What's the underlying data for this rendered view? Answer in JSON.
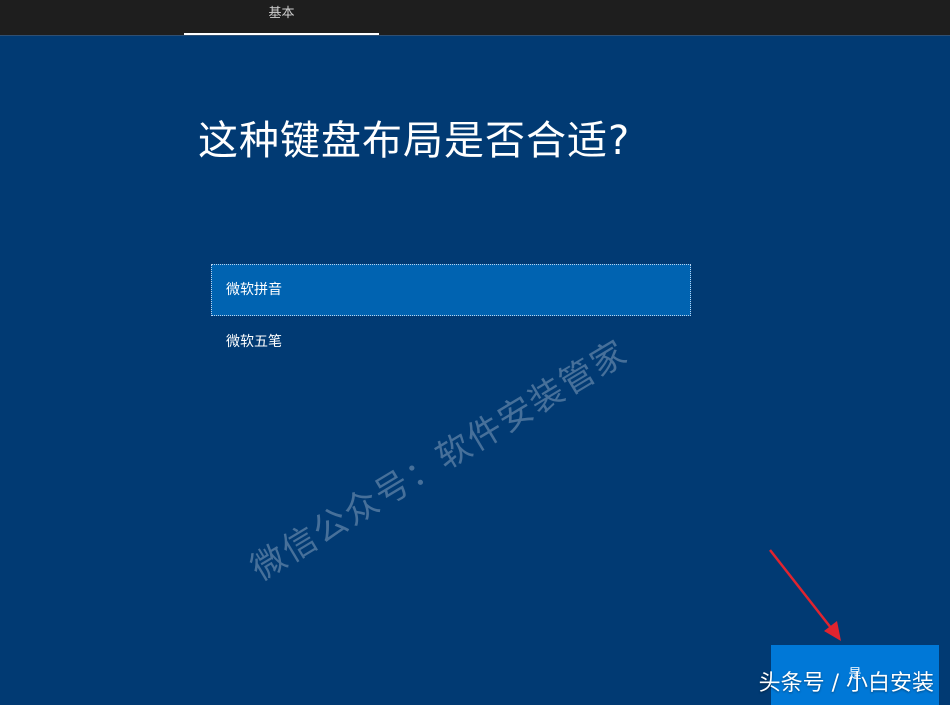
{
  "header": {
    "tabs": [
      {
        "label": "基本",
        "active": true
      }
    ]
  },
  "main": {
    "title": "这种键盘布局是否合适?",
    "layouts": [
      {
        "label": "微软拼音",
        "selected": true
      },
      {
        "label": "微软五笔",
        "selected": false
      }
    ]
  },
  "footer": {
    "yes_label": "是"
  },
  "overlay": {
    "watermark": "微信公众号：软件安装管家",
    "credit": "头条号 / 小白安装"
  },
  "colors": {
    "background": "#013a73",
    "topbar": "#1e1e1e",
    "selected_item": "#0063b1",
    "primary_button": "#0078d7",
    "arrow": "#e0242f"
  }
}
